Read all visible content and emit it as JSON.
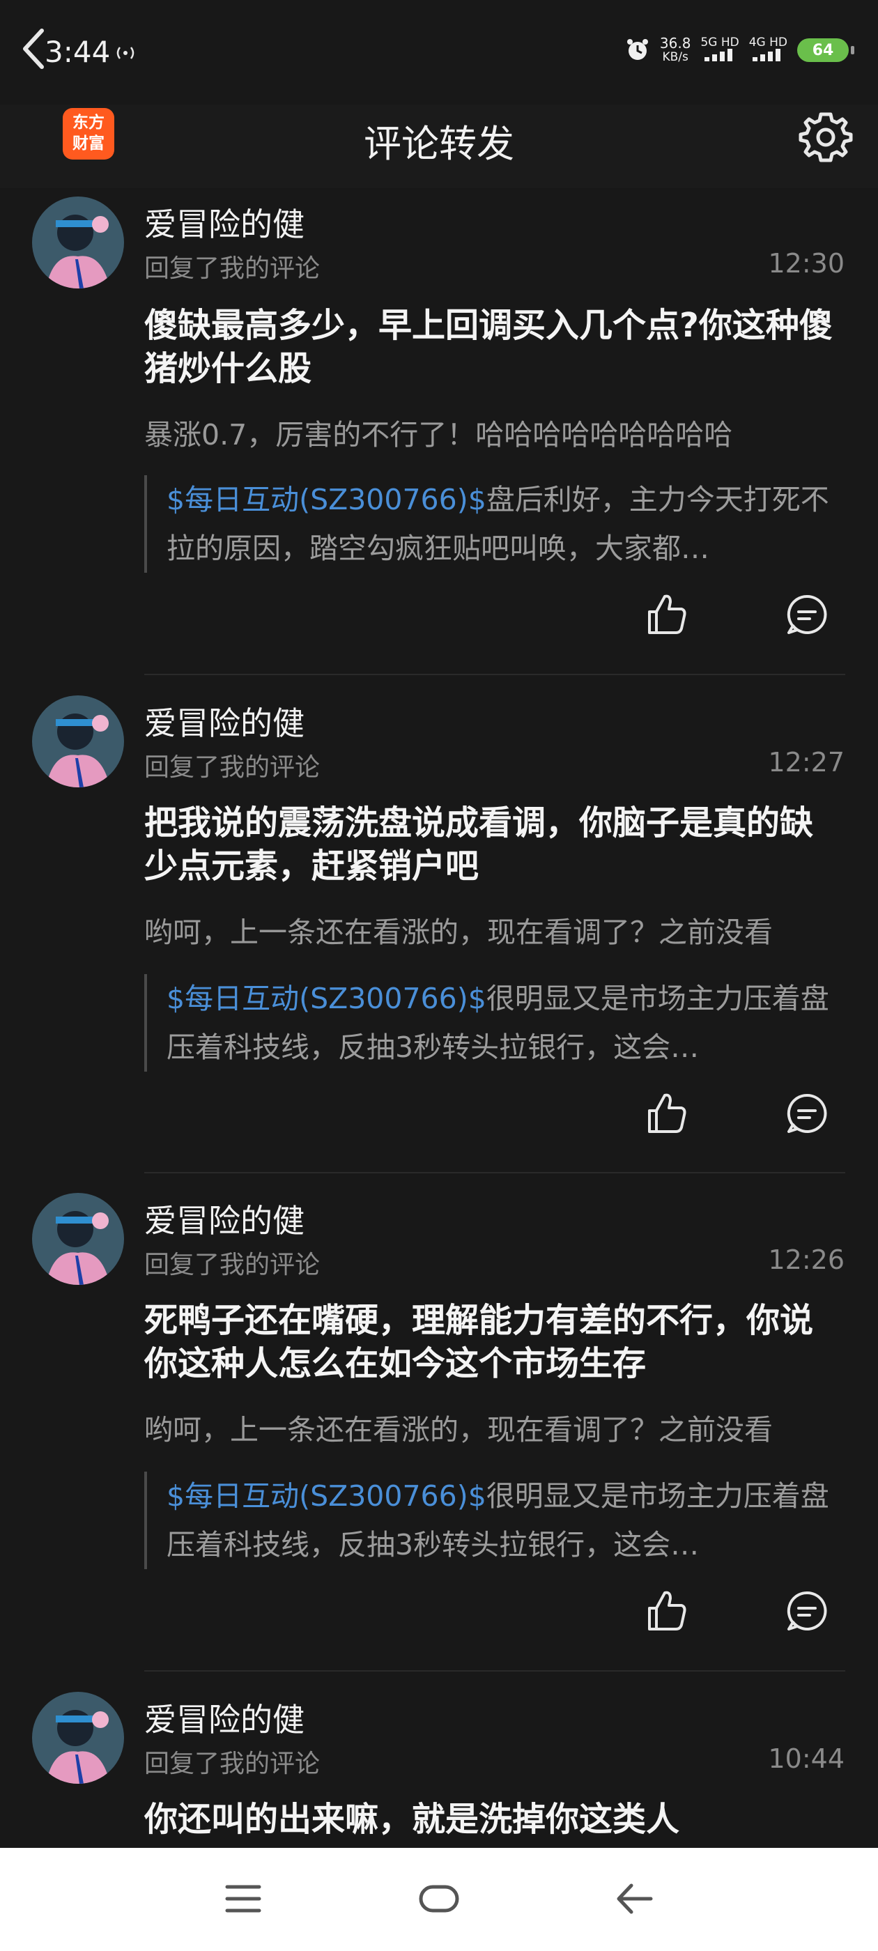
{
  "status": {
    "time": "3:44",
    "speed_value": "36.8",
    "speed_unit": "KB/s",
    "net1": "5G HD",
    "net2": "4G HD",
    "battery": "64"
  },
  "header": {
    "title": "评论转发",
    "logo_line1": "东方",
    "logo_line2": "财富"
  },
  "colors": {
    "background": "#181818",
    "stock_link": "#4a8fd8",
    "logo": "#ff5a1f",
    "battery": "#6abf4b"
  },
  "items": [
    {
      "username": "爱冒险的健",
      "subline": "回复了我的评论",
      "time": "12:30",
      "reply": "傻缺最高多少，早上回调买入几个点?你这种傻猪炒什么股",
      "orig": "暴涨0.7，厉害的不行了！哈哈哈哈哈哈哈哈哈",
      "stock": "$每日互动(SZ300766)$",
      "quote": "盘后利好，主力今天打死不拉的原因，踏空勾疯狂贴吧叫唤，大家都…"
    },
    {
      "username": "爱冒险的健",
      "subline": "回复了我的评论",
      "time": "12:27",
      "reply": "把我说的震荡洗盘说成看调，你脑子是真的缺少点元素，赶紧销户吧",
      "orig": "哟呵，上一条还在看涨的，现在看调了？之前没看",
      "stock": "$每日互动(SZ300766)$",
      "quote": "很明显又是市场主力压着盘压着科技线，反抽3秒转头拉银行，这会…"
    },
    {
      "username": "爱冒险的健",
      "subline": "回复了我的评论",
      "time": "12:26",
      "reply": "死鸭子还在嘴硬，理解能力有差的不行，你说你这种人怎么在如今这个市场生存",
      "orig": "哟呵，上一条还在看涨的，现在看调了？之前没看",
      "stock": "$每日互动(SZ300766)$",
      "quote": "很明显又是市场主力压着盘压着科技线，反抽3秒转头拉银行，这会…"
    },
    {
      "username": "爱冒险的健",
      "subline": "回复了我的评论",
      "time": "10:44",
      "reply": "你还叫的出来嘛，就是洗掉你这类人"
    }
  ]
}
